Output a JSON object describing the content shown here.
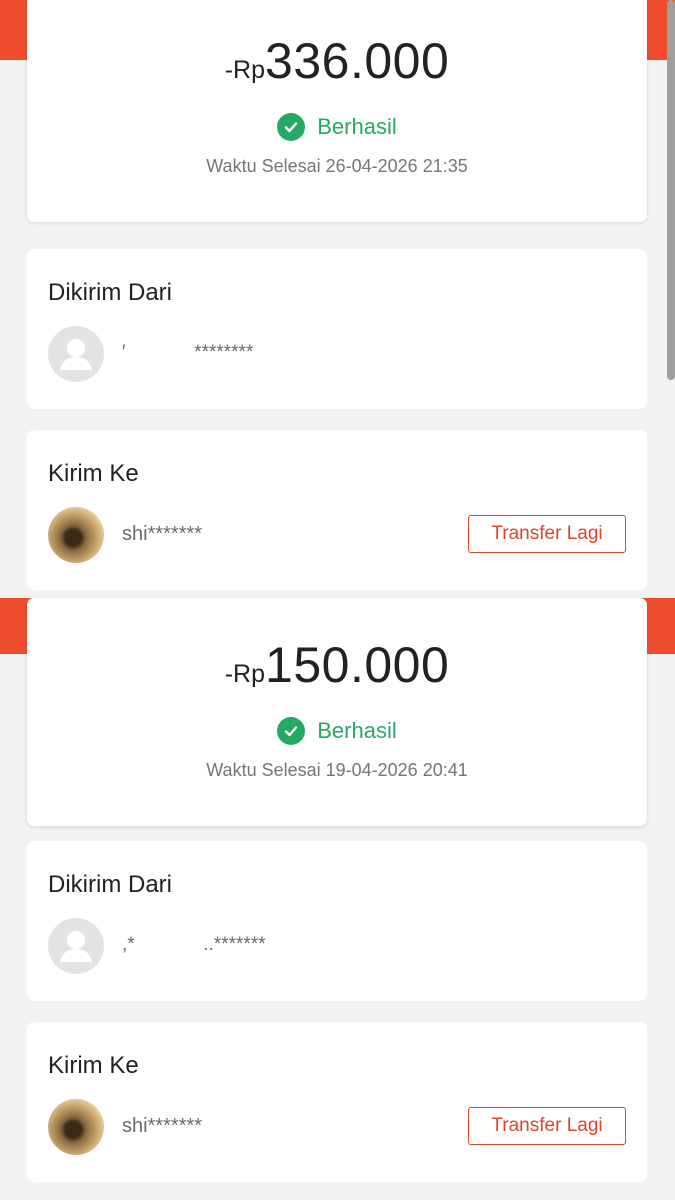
{
  "transactions": [
    {
      "currency": "-Rp",
      "amount": "336.000",
      "status": "Berhasil",
      "completed_time": "Waktu Selesai 26-04-2026 21:35",
      "sender": {
        "title": "Dikirim Dari",
        "name": "′             ********"
      },
      "recipient": {
        "title": "Kirim Ke",
        "name": "shi*******",
        "button_label": "Transfer Lagi"
      }
    },
    {
      "currency": "-Rp",
      "amount": "150.000",
      "status": "Berhasil",
      "completed_time": "Waktu Selesai 19-04-2026 20:41",
      "sender": {
        "title": "Dikirim Dari",
        "name": ",*             ..*******"
      },
      "recipient": {
        "title": "Kirim Ke",
        "name": "shi*******",
        "button_label": "Transfer Lagi"
      }
    }
  ],
  "colors": {
    "accent": "#ee4d2d",
    "success": "#26aa63",
    "button_border": "#d9472b"
  },
  "icons": {
    "status": "check-circle-icon",
    "default_avatar": "user-silhouette-icon",
    "recipient_avatar": "profile-photo"
  }
}
